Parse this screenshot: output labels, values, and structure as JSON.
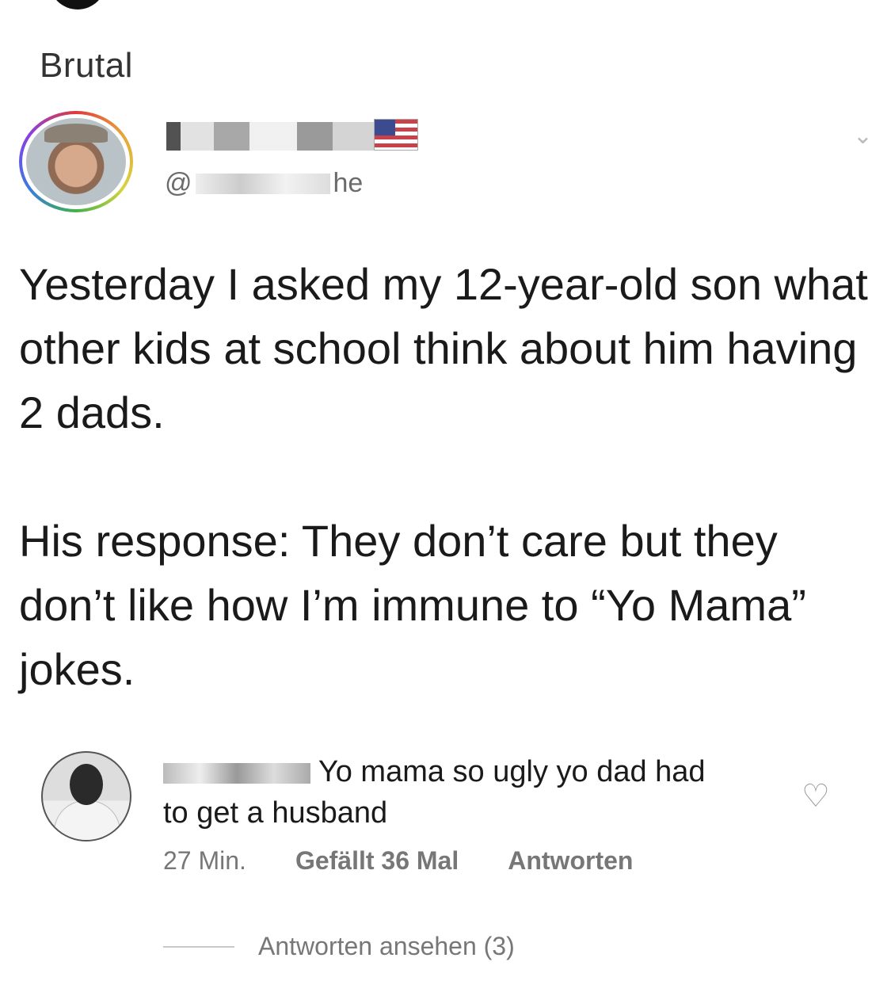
{
  "post": {
    "title": "Brutal"
  },
  "tweet": {
    "handle_prefix": "@",
    "handle_suffix": "he",
    "paragraphs": [
      "Yesterday I asked my 12-year-old son what other kids at school think about him having 2 dads.",
      "His response: They don’t care but they don’t like how I’m immune to “Yo Mama” jokes."
    ]
  },
  "comment": {
    "text_line1": "Yo mama so ugly yo dad had",
    "text_line2": "to get a husband",
    "time": "27 Min.",
    "likes": "Gefällt 36 Mal",
    "reply_label": "Antworten",
    "view_replies": "Antworten ansehen (3)"
  },
  "icons": {
    "chevron": "chevron-down-icon",
    "heart": "heart-icon",
    "flag": "us-flag-icon"
  }
}
